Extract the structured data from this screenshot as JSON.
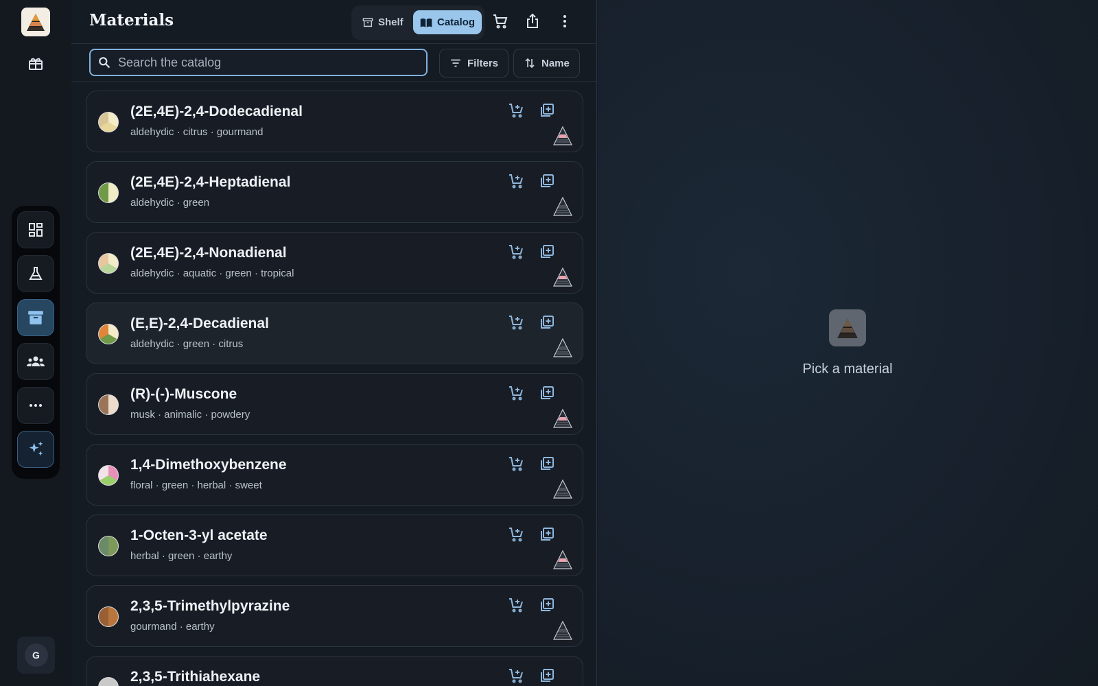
{
  "colors": {
    "accent": "#9ac6ec",
    "background": "#151b23",
    "card": "#181d25",
    "icon": "#8fb7dd"
  },
  "header": {
    "title": "Materials",
    "view_tabs": [
      {
        "label": "Shelf",
        "icon": "archive-icon",
        "selected": false
      },
      {
        "label": "Catalog",
        "icon": "book-icon",
        "selected": true
      }
    ],
    "actions": [
      "cart-icon",
      "share-icon",
      "more-vertical-icon"
    ]
  },
  "search": {
    "placeholder": "Search the catalog",
    "value": ""
  },
  "toolbar": {
    "filters_label": "Filters",
    "sort_label": "Name"
  },
  "rail": {
    "avatar_initial": "G",
    "nav_icons": [
      "dashboard-icon",
      "flask-icon",
      "archive-icon",
      "people-icon",
      "more-horizontal-icon",
      "sparkle-icon"
    ],
    "active_nav": "archive-icon"
  },
  "materials": [
    {
      "name": "(2E,4E)-2,4-Dodecadienal",
      "tags": "aldehydic · citrus · gourmand",
      "swatch": [
        "#f4ecc8",
        "#e8d69b",
        "#d8c494"
      ]
    },
    {
      "name": "(2E,4E)-2,4-Heptadienal",
      "tags": "aldehydic · green",
      "swatch": [
        "#f2ecc6",
        "#6f9a48"
      ]
    },
    {
      "name": "(2E,4E)-2,4-Nonadienal",
      "tags": "aldehydic · aquatic · green · tropical",
      "swatch": [
        "#f3eccb",
        "#b8d59a",
        "#e7c6a0"
      ]
    },
    {
      "name": "(E,E)-2,4-Decadienal",
      "tags": "aldehydic · green · citrus",
      "swatch": [
        "#f3ecc8",
        "#6f9a48",
        "#e0853a"
      ]
    },
    {
      "name": "(R)-(-)-Muscone",
      "tags": "musk · animalic · powdery",
      "swatch": [
        "#ecdccb",
        "#9a7458"
      ]
    },
    {
      "name": "1,4-Dimethoxybenzene",
      "tags": "floral · green · herbal · sweet",
      "swatch": [
        "#e890b8",
        "#9ad06b",
        "#f2e3ea"
      ]
    },
    {
      "name": "1-Octen-3-yl acetate",
      "tags": "herbal · green · earthy",
      "swatch": [
        "#7e9a5a",
        "#6a8a68"
      ]
    },
    {
      "name": "2,3,5-Trimethylpyrazine",
      "tags": "gourmand · earthy",
      "swatch": [
        "#b9763c",
        "#9a5e34"
      ]
    },
    {
      "name": "2,3,5-Trithiahexane",
      "tags": "",
      "swatch": [
        "#c9c9c9"
      ]
    }
  ],
  "empty_state": {
    "text": "Pick a material"
  }
}
